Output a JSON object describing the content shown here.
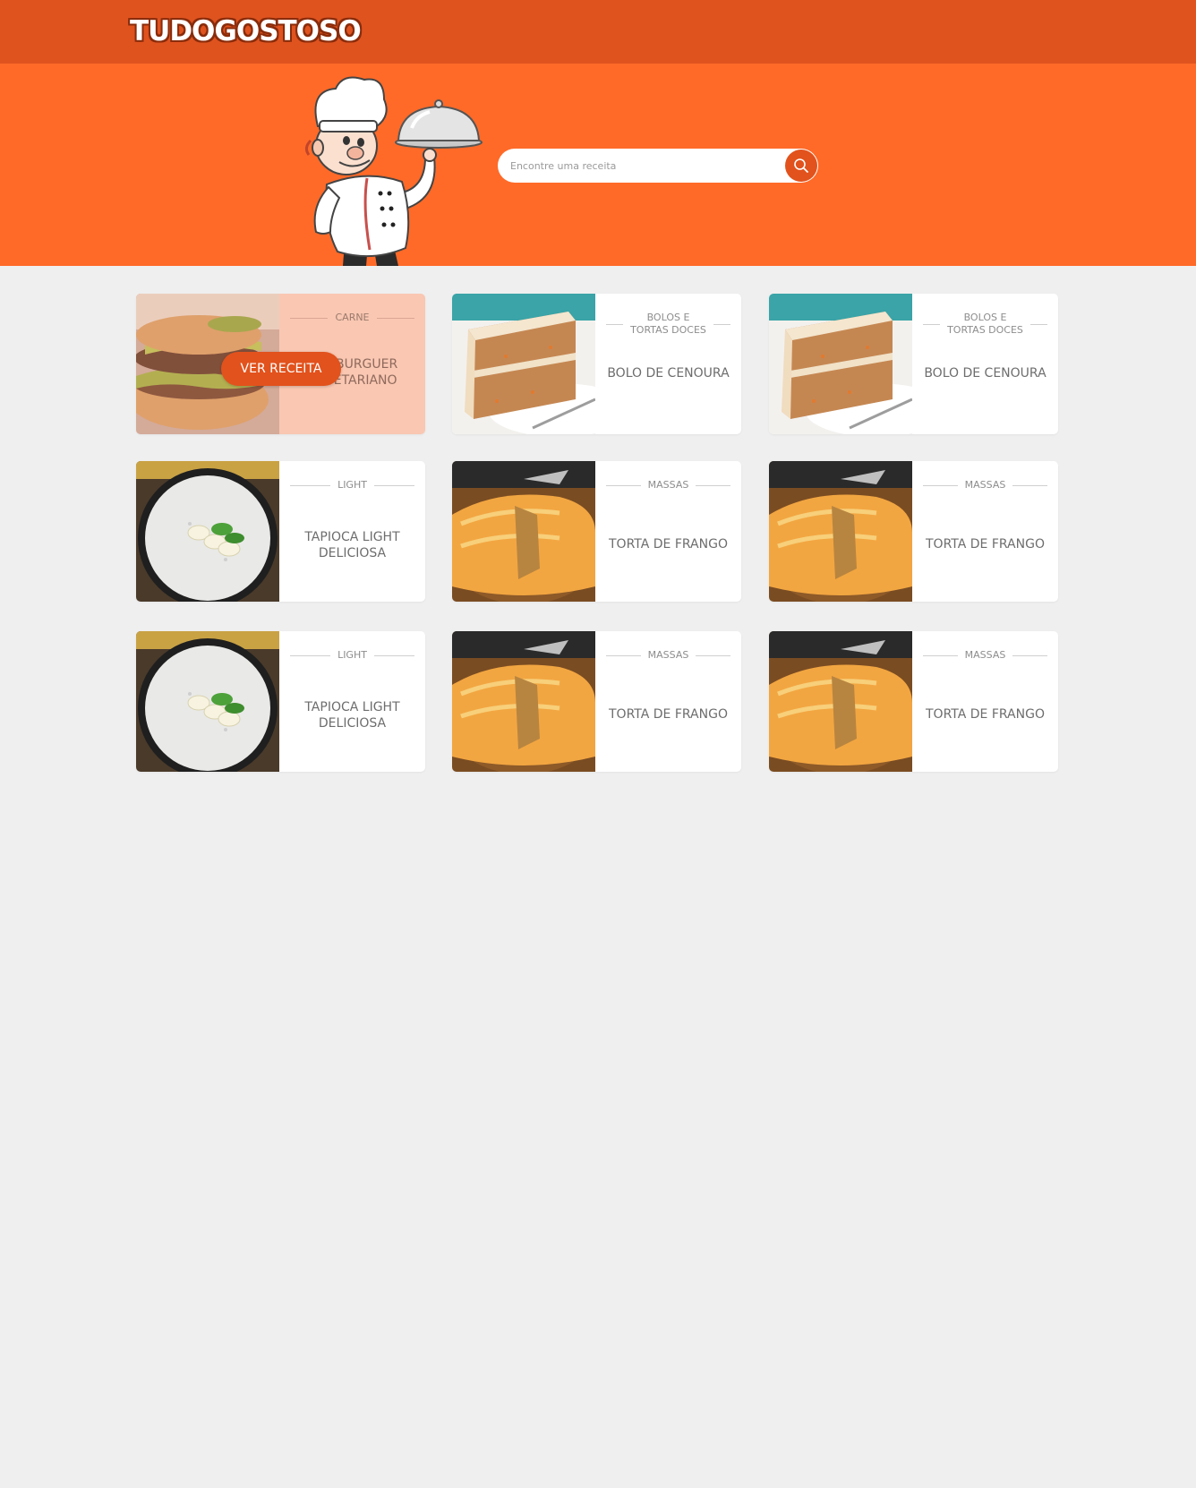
{
  "header": {
    "logo_text": "TUDOGOSTOSO"
  },
  "hero": {
    "search": {
      "placeholder": "Encontre uma receita"
    }
  },
  "colors": {
    "topbar": "#df531f",
    "hero": "#ff6a28",
    "accent": "#e2521c",
    "active_card": "#f9c7b2",
    "page_bg": "#efefef"
  },
  "cards": [
    {
      "category": "CARNE",
      "title": "HAMBURGUER\nVEGETARIANO",
      "image": "burger",
      "button": "VER RECEITA"
    },
    {
      "category": "BOLOS E\nTORTAS DOCES",
      "title": "BOLO DE CENOURA",
      "image": "cake"
    },
    {
      "category": "BOLOS E\nTORTAS DOCES",
      "title": "BOLO DE CENOURA",
      "image": "cake"
    },
    {
      "category": "LIGHT",
      "title": "TAPIOCA LIGHT\nDELICIOSA",
      "image": "tapioca"
    },
    {
      "category": "MASSAS",
      "title": "TORTA DE FRANGO",
      "image": "pie"
    },
    {
      "category": "MASSAS",
      "title": "TORTA DE FRANGO",
      "image": "pie"
    },
    {
      "category": "LIGHT",
      "title": "TAPIOCA LIGHT\nDELICIOSA",
      "image": "tapioca"
    },
    {
      "category": "MASSAS",
      "title": "TORTA DE FRANGO",
      "image": "pie"
    },
    {
      "category": "MASSAS",
      "title": "TORTA DE FRANGO",
      "image": "pie"
    }
  ]
}
